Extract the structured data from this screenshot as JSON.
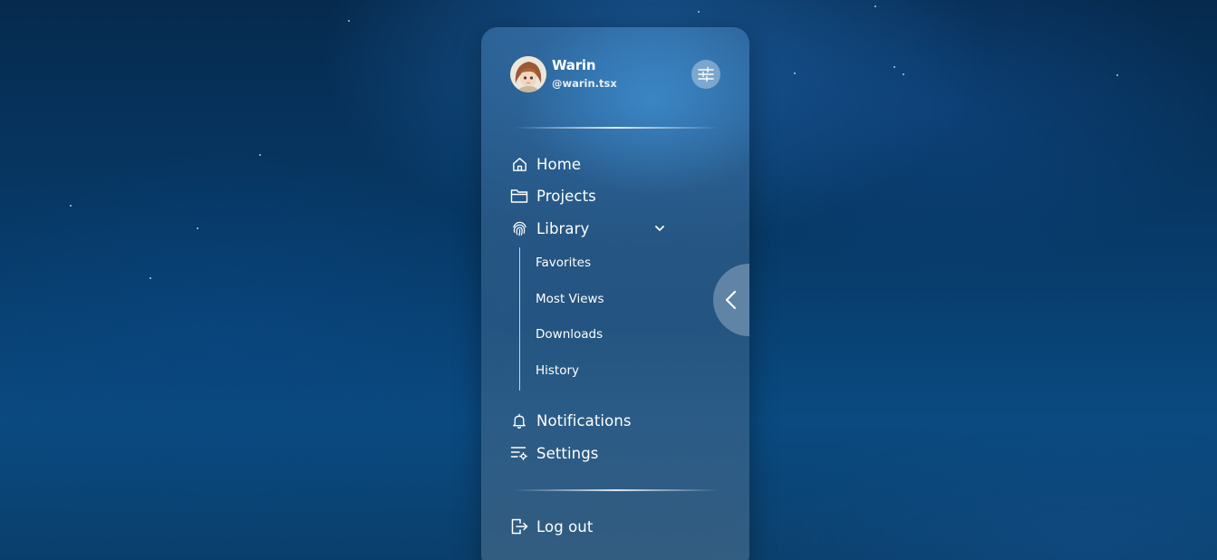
{
  "user": {
    "name": "Warin",
    "handle": "@warin.tsx"
  },
  "nav": {
    "items": [
      {
        "label": "Home",
        "icon": "home-icon"
      },
      {
        "label": "Projects",
        "icon": "folder-icon"
      },
      {
        "label": "Library",
        "icon": "fingerprint-icon",
        "expanded": true
      }
    ],
    "library_sub_items": [
      {
        "label": "Favorites"
      },
      {
        "label": "Most Views"
      },
      {
        "label": "Downloads"
      },
      {
        "label": "History"
      }
    ],
    "secondary_items": [
      {
        "label": "Notifications",
        "icon": "bell-icon"
      },
      {
        "label": "Settings",
        "icon": "settings-list-icon"
      }
    ],
    "logout_label": "Log out"
  },
  "colors": {
    "background": "#073b6a",
    "text": "#ffffff",
    "panel": "#46789f"
  }
}
